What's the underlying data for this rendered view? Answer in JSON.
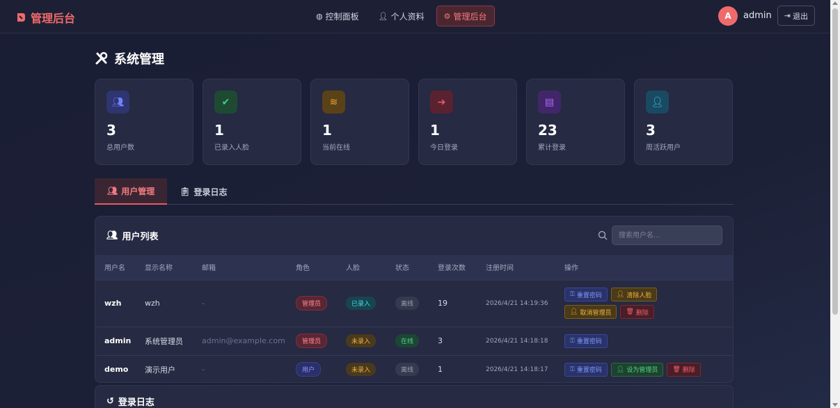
{
  "brand": {
    "name": "管理后台"
  },
  "nav": [
    {
      "label": "控制面板",
      "icon": "dashboard-icon"
    },
    {
      "label": "个人资料",
      "icon": "user-icon"
    },
    {
      "label": "管理后台",
      "icon": "gear-icon",
      "active": true
    }
  ],
  "user": {
    "avatar_letter": "A",
    "name": "admin",
    "logout_label": "退出"
  },
  "page": {
    "title": "系统管理"
  },
  "stats": [
    {
      "value": "3",
      "label": "总用户数",
      "icon": "users-icon",
      "color": "#4f63e8"
    },
    {
      "value": "1",
      "label": "已录入人脸",
      "icon": "user-check-icon",
      "color": "#2fb56a"
    },
    {
      "value": "1",
      "label": "当前在线",
      "icon": "wifi-icon",
      "color": "#e8a030"
    },
    {
      "value": "1",
      "label": "今日登录",
      "icon": "sign-in-icon",
      "color": "#e04a5a"
    },
    {
      "value": "23",
      "label": "累计登录",
      "icon": "chart-icon",
      "color": "#9a4ae8"
    },
    {
      "value": "3",
      "label": "周活跃用户",
      "icon": "user-clock-icon",
      "color": "#2ab8e0"
    }
  ],
  "tabs": [
    {
      "label": "用户管理",
      "icon": "users-cog-icon",
      "active": true
    },
    {
      "label": "登录日志",
      "icon": "clipboard-icon"
    }
  ],
  "user_list": {
    "title": "用户列表",
    "search_placeholder": "搜索用户名...",
    "columns": [
      "用户名",
      "显示名称",
      "邮箱",
      "角色",
      "人脸",
      "状态",
      "登录次数",
      "注册时间",
      "操作"
    ],
    "rows": [
      {
        "username": "wzh",
        "display": "wzh",
        "email": "-",
        "role": "管理员",
        "role_type": "admin",
        "face": "已录入",
        "face_type": "yes",
        "status": "离线",
        "status_type": "off",
        "logins": "19",
        "registered": "2026/4/21 14:19:36",
        "actions": [
          {
            "label": "重置密码",
            "style": "blue",
            "icon": "key-icon"
          },
          {
            "label": "清除人脸",
            "style": "amber",
            "icon": "user-x-icon"
          },
          {
            "label": "取消管理员",
            "style": "amber",
            "icon": "user-minus-icon"
          },
          {
            "label": "删除",
            "style": "red",
            "icon": "trash-icon"
          }
        ]
      },
      {
        "username": "admin",
        "display": "系统管理员",
        "email": "admin@example.com",
        "role": "管理员",
        "role_type": "admin",
        "face": "未录入",
        "face_type": "no",
        "status": "在线",
        "status_type": "on",
        "logins": "3",
        "registered": "2026/4/21 14:18:18",
        "actions": [
          {
            "label": "重置密码",
            "style": "blue",
            "icon": "key-icon"
          }
        ]
      },
      {
        "username": "demo",
        "display": "演示用户",
        "email": "-",
        "role": "用户",
        "role_type": "user",
        "face": "未录入",
        "face_type": "no",
        "status": "离线",
        "status_type": "off",
        "logins": "1",
        "registered": "2026/4/21 14:18:17",
        "actions": [
          {
            "label": "重置密码",
            "style": "blue",
            "icon": "key-icon"
          },
          {
            "label": "设为管理员",
            "style": "green",
            "icon": "user-shield-icon"
          },
          {
            "label": "删除",
            "style": "red",
            "icon": "trash-icon"
          }
        ]
      }
    ]
  },
  "login_log": {
    "title": "登录日志"
  }
}
